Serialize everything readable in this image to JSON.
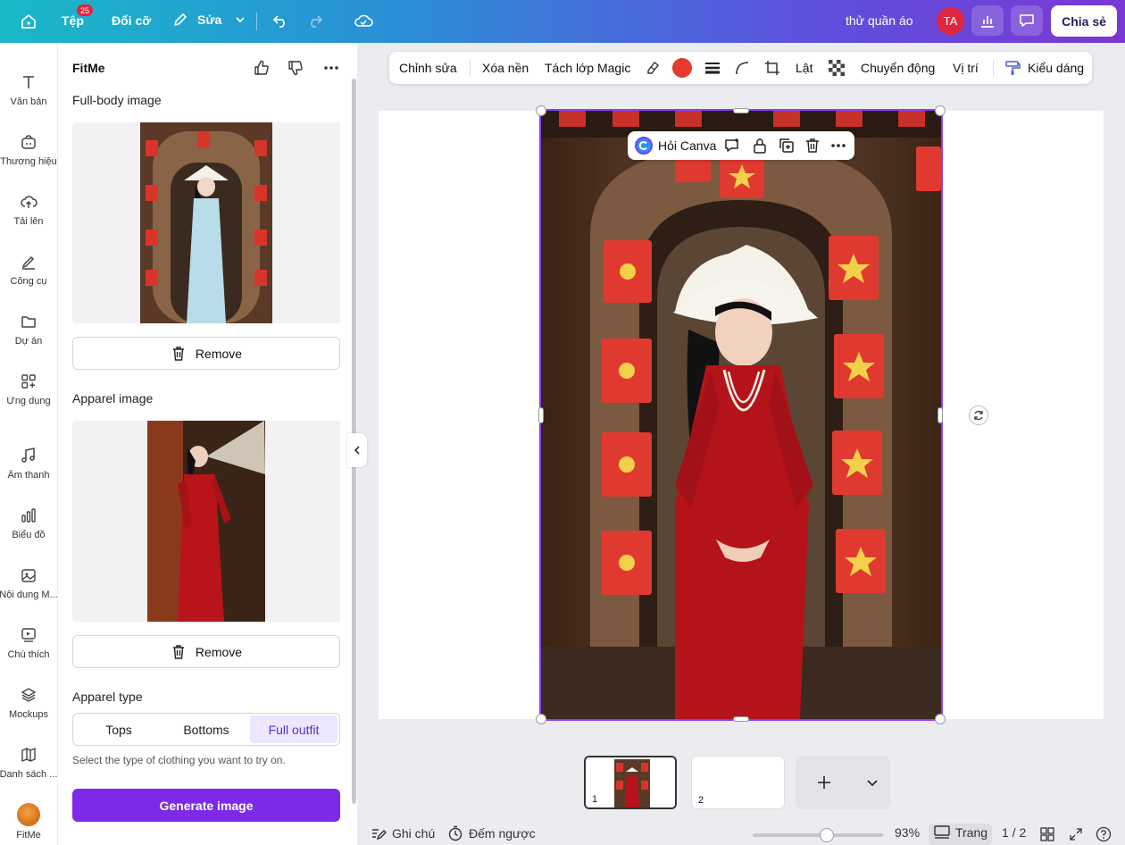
{
  "topbar": {
    "file": "Tệp",
    "file_badge": "25",
    "resize": "Đổi cỡ",
    "edit": "Sửa",
    "doc_title": "thử quần áo",
    "avatar": "TA",
    "share": "Chia sẻ"
  },
  "rail": [
    {
      "label": "Văn bản",
      "icon": "text-icon"
    },
    {
      "label": "Thương hiệu",
      "icon": "brand-icon"
    },
    {
      "label": "Tải lên",
      "icon": "upload-cloud-icon"
    },
    {
      "label": "Công cụ",
      "icon": "tools-icon"
    },
    {
      "label": "Dự án",
      "icon": "folder-icon"
    },
    {
      "label": "Ứng dụng",
      "icon": "apps-icon"
    },
    {
      "label": "Âm thanh",
      "icon": "music-icon"
    },
    {
      "label": "Biểu đồ",
      "icon": "chart-icon"
    },
    {
      "label": "Nội dung M...",
      "icon": "magic-media-icon"
    },
    {
      "label": "Chú thích",
      "icon": "caption-icon"
    },
    {
      "label": "Mockups",
      "icon": "mockups-icon"
    },
    {
      "label": "Danh sách ...",
      "icon": "list-icon"
    },
    {
      "label": "FitMe",
      "icon": "fitme-app-icon"
    }
  ],
  "panel": {
    "title": "FitMe",
    "full_body_title": "Full-body image",
    "remove_label": "Remove",
    "apparel_title": "Apparel image",
    "apparel_type_title": "Apparel type",
    "apparel_options": [
      "Tops",
      "Bottoms",
      "Full outfit"
    ],
    "apparel_selected": "Full outfit",
    "hint": "Select the type of clothing you want to try on.",
    "generate": "Generate image"
  },
  "edit_toolbar": {
    "edit": "Chỉnh sửa",
    "remove_bg": "Xóa nền",
    "magic_layer": "Tách lớp Magic",
    "color": "#e33b2e",
    "flip": "Lật",
    "animate": "Chuyển động",
    "position": "Vị trí",
    "style": "Kiểu dáng"
  },
  "float_bar": {
    "ask": "Hỏi Canva"
  },
  "pages": {
    "thumb1": "1",
    "thumb2": "2"
  },
  "bottombar": {
    "notes": "Ghi chú",
    "timer": "Đếm ngược",
    "zoom": "93%",
    "zoom_fraction": 0.57,
    "pages_label": "Trang",
    "page_count": "1 / 2"
  }
}
